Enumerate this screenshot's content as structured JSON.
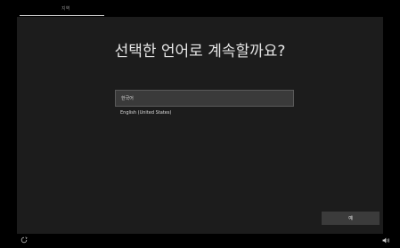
{
  "header": {
    "step_label": "지역"
  },
  "main": {
    "heading": "선택한 언어로 계속할까요?",
    "languages": [
      {
        "label": "한국어",
        "selected": true
      },
      {
        "label": "English (United States)",
        "selected": false
      }
    ],
    "next_label": "예"
  },
  "footer": {
    "left_icon": "ease-of-access-icon",
    "right_icon": "volume-icon"
  },
  "colors": {
    "background": "#000000",
    "panel": "#1c1c1c",
    "selected_item": "#3a3a3a",
    "button": "#3b3b3b"
  }
}
